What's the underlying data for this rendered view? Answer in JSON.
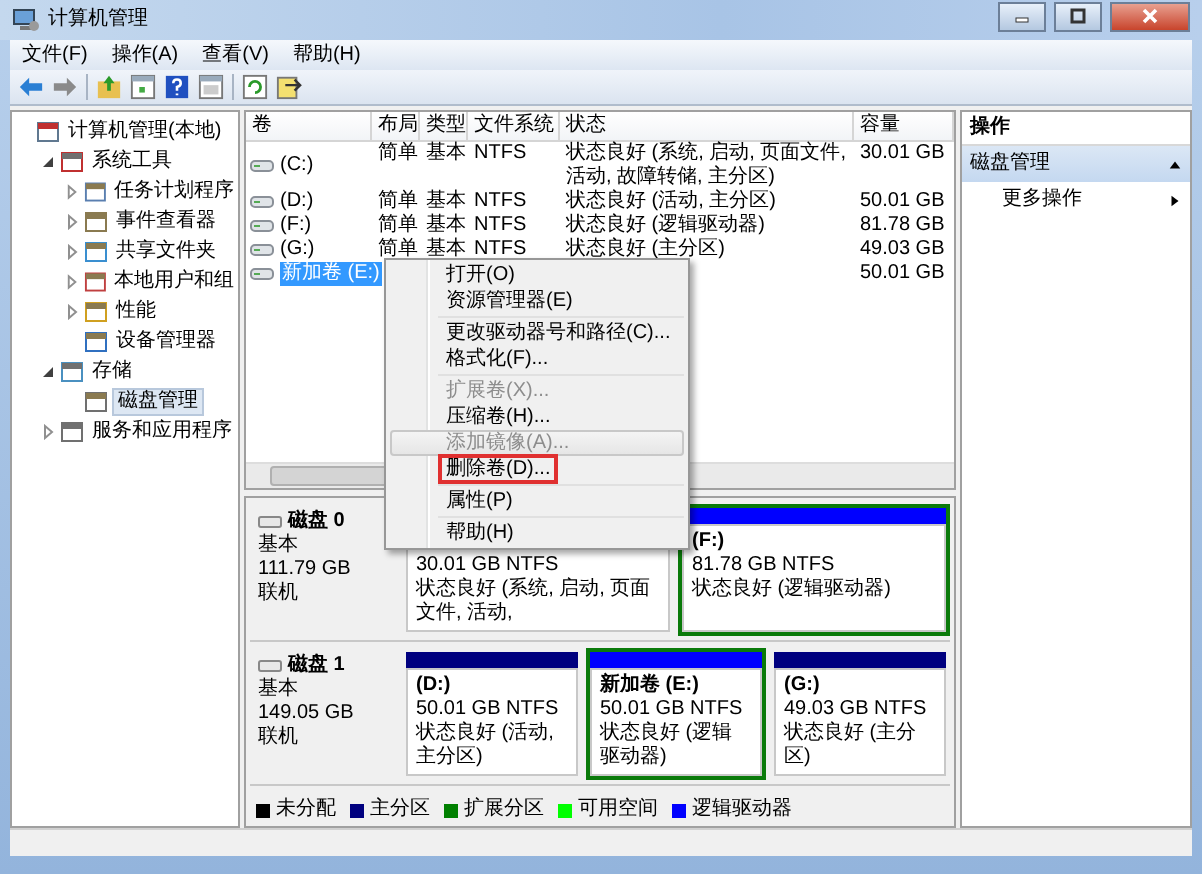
{
  "window": {
    "title": "计算机管理"
  },
  "menu_bar": [
    "文件(F)",
    "操作(A)",
    "查看(V)",
    "帮助(H)"
  ],
  "tree": [
    {
      "label": "计算机管理(本地)",
      "selected": false,
      "children": [
        {
          "label": "系统工具",
          "selected": false,
          "expanded": true,
          "children": [
            {
              "label": "任务计划程序",
              "selected": false,
              "expanded": false
            },
            {
              "label": "事件查看器",
              "selected": false,
              "expanded": false
            },
            {
              "label": "共享文件夹",
              "selected": false,
              "expanded": false
            },
            {
              "label": "本地用户和组",
              "selected": false,
              "expanded": false
            },
            {
              "label": "性能",
              "selected": false,
              "expanded": false
            },
            {
              "label": "设备管理器",
              "selected": false
            }
          ]
        },
        {
          "label": "存储",
          "selected": false,
          "expanded": true,
          "children": [
            {
              "label": "磁盘管理",
              "selected": true
            }
          ]
        },
        {
          "label": "服务和应用程序",
          "selected": false,
          "expanded": false
        }
      ]
    }
  ],
  "table": {
    "columns": [
      "卷",
      "布局",
      "类型",
      "文件系统",
      "状态",
      "容量"
    ],
    "rows": [
      {
        "selected": false,
        "cells": [
          "(C:)",
          "简单",
          "基本",
          "NTFS",
          "状态良好 (系统, 启动, 页面文件, 活动, 故障转储, 主分区)",
          "30.01 GB"
        ]
      },
      {
        "selected": false,
        "cells": [
          "(D:)",
          "简单",
          "基本",
          "NTFS",
          "状态良好 (活动, 主分区)",
          "50.01 GB"
        ]
      },
      {
        "selected": false,
        "cells": [
          "(F:)",
          "简单",
          "基本",
          "NTFS",
          "状态良好 (逻辑驱动器)",
          "81.78 GB"
        ]
      },
      {
        "selected": false,
        "cells": [
          "(G:)",
          "简单",
          "基本",
          "NTFS",
          "状态良好 (主分区)",
          "49.03 GB"
        ]
      },
      {
        "selected": true,
        "cells": [
          "新加卷 (E:)",
          null,
          null,
          null,
          null,
          "50.01 GB"
        ]
      }
    ]
  },
  "disks": [
    {
      "name": "磁盘 0",
      "type": "基本",
      "size": "111.79 GB",
      "status": "联机",
      "partitions": [
        {
          "size": "30.01 GB NTFS",
          "status": "状态良好 (系统, 启动, 页面文件, 活动,",
          "extended": false
        },
        {
          "label": "(F:)",
          "size": "81.78 GB NTFS",
          "status": "状态良好 (逻辑驱动器)",
          "color": "#0000ff",
          "extended": true
        }
      ]
    },
    {
      "name": "磁盘 1",
      "type": "基本",
      "size": "149.05 GB",
      "status": "联机",
      "partitions": [
        {
          "label": "(D:)",
          "size": "50.01 GB NTFS",
          "status": "状态良好 (活动, 主分区)",
          "color": "#00007f",
          "extended": false
        },
        {
          "label": "新加卷  (E:)",
          "size": "50.01 GB NTFS",
          "status": "状态良好 (逻辑驱动器)",
          "color": "#0000ff",
          "extended": true
        },
        {
          "label": "(G:)",
          "size": "49.03 GB NTFS",
          "status": "状态良好 (主分区)",
          "color": "#00007f",
          "extended": false
        }
      ]
    }
  ],
  "legend": [
    {
      "label": "未分配",
      "color": "#000000"
    },
    {
      "label": "主分区",
      "color": "#00007f"
    },
    {
      "label": "扩展分区",
      "color": "#008000"
    },
    {
      "label": "可用空间",
      "color": "#00ff00"
    },
    {
      "label": "逻辑驱动器",
      "color": "#0000ff"
    }
  ],
  "actions": {
    "header": "操作",
    "items": [
      {
        "kind": "section",
        "label": "磁盘管理"
      },
      {
        "kind": "submenu",
        "label": "更多操作"
      }
    ]
  },
  "context_menu": {
    "items": [
      {
        "kind": "command",
        "label": "打开(O)",
        "disabled": false,
        "highlighted": false,
        "outlined": false
      },
      {
        "kind": "command",
        "label": "资源管理器(E)",
        "disabled": false,
        "highlighted": false,
        "outlined": false
      },
      {
        "kind": "separator"
      },
      {
        "kind": "command",
        "label": "更改驱动器号和路径(C)...",
        "disabled": false,
        "highlighted": false,
        "outlined": false
      },
      {
        "kind": "command",
        "label": "格式化(F)...",
        "disabled": false,
        "highlighted": false,
        "outlined": false
      },
      {
        "kind": "separator"
      },
      {
        "kind": "command",
        "label": "扩展卷(X)...",
        "disabled": true,
        "highlighted": false,
        "outlined": false
      },
      {
        "kind": "command",
        "label": "压缩卷(H)...",
        "disabled": false,
        "highlighted": false,
        "outlined": false
      },
      {
        "kind": "command",
        "label": "添加镜像(A)...",
        "disabled": true,
        "highlighted": true,
        "outlined": false
      },
      {
        "kind": "command",
        "label": "删除卷(D)...",
        "disabled": false,
        "highlighted": false,
        "outlined": true
      },
      {
        "kind": "separator"
      },
      {
        "kind": "command",
        "label": "属性(P)",
        "disabled": false,
        "highlighted": false,
        "outlined": false
      },
      {
        "kind": "separator"
      },
      {
        "kind": "command",
        "label": "帮助(H)",
        "disabled": false,
        "highlighted": false,
        "outlined": false
      }
    ]
  }
}
